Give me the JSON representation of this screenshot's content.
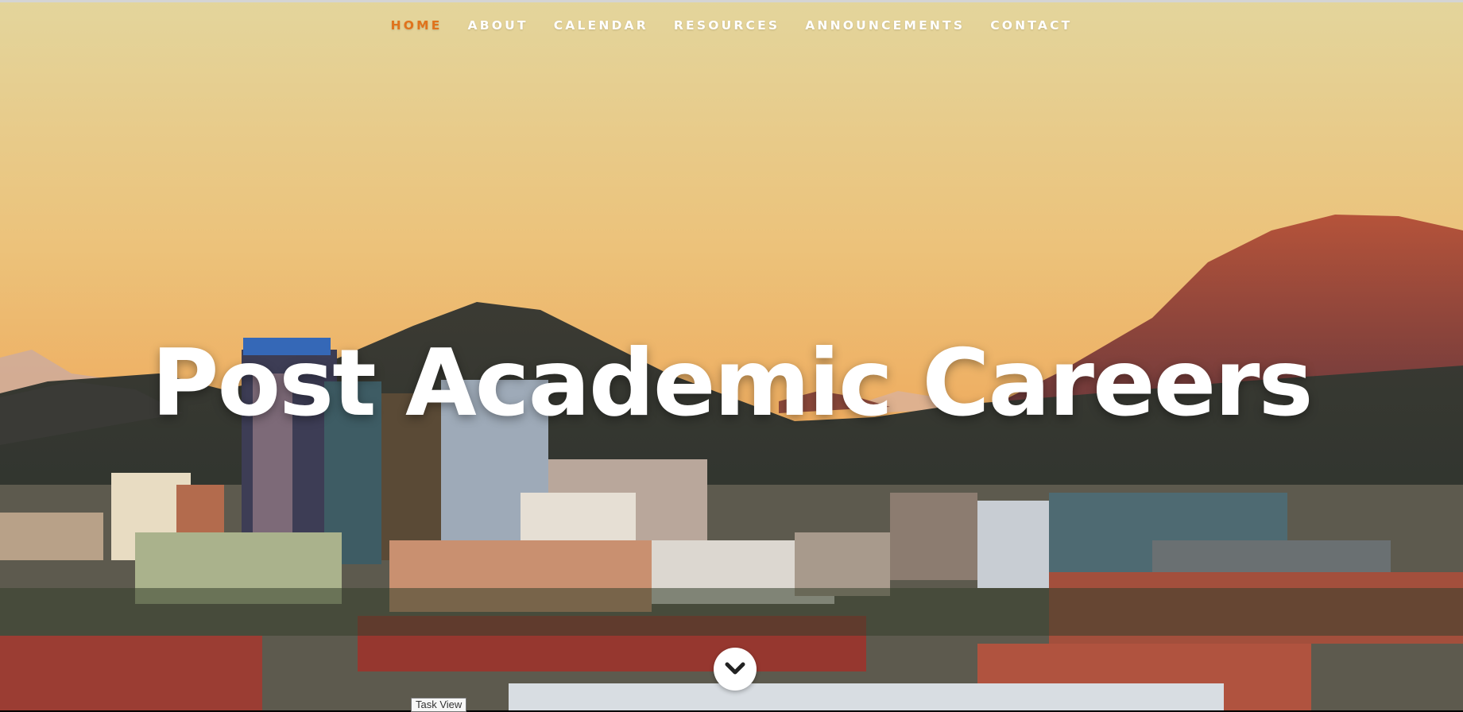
{
  "nav": {
    "items": [
      {
        "label": "HOME",
        "active": true
      },
      {
        "label": "ABOUT",
        "active": false
      },
      {
        "label": "CALENDAR",
        "active": false
      },
      {
        "label": "RESOURCES",
        "active": false
      },
      {
        "label": "ANNOUNCEMENTS",
        "active": false
      },
      {
        "label": "CONTACT",
        "active": false
      }
    ]
  },
  "hero": {
    "title": "Post Academic Careers",
    "scroll_icon": "chevron-down-icon"
  },
  "tooltip": {
    "text": "Task View"
  },
  "colors": {
    "nav_active": "#e0731c",
    "nav_text": "#ffffff",
    "sky_top": "#e4d39a",
    "sky_bottom": "#eeaa5c"
  }
}
